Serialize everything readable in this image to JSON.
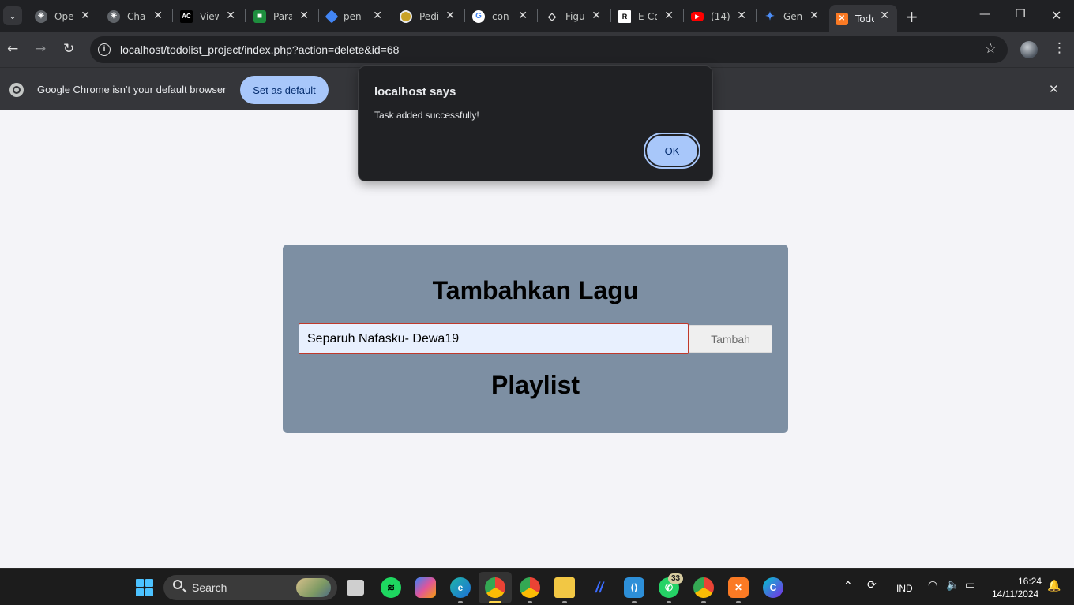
{
  "browser": {
    "tabs": [
      {
        "title": "Ope",
        "icon": "openai-icon",
        "color": "#5f6368"
      },
      {
        "title": "Cha",
        "icon": "chatgpt-icon",
        "color": "#5f6368"
      },
      {
        "title": "View",
        "icon": "ac-icon",
        "color": "#000000"
      },
      {
        "title": "Para",
        "icon": "robot-icon",
        "color": "#1e8e3e"
      },
      {
        "title": "pen",
        "icon": "graduation-cap-icon",
        "color": "#4285f4"
      },
      {
        "title": "Pedi",
        "icon": "university-seal-icon",
        "color": "#c9a227"
      },
      {
        "title": "con",
        "icon": "google-icon",
        "color": "#4285f4"
      },
      {
        "title": "Figu",
        "icon": "figure-icon",
        "color": "#5f6368"
      },
      {
        "title": "E-Co",
        "icon": "re-icon",
        "color": "#ffffff"
      },
      {
        "title": "(14)",
        "icon": "youtube-icon",
        "color": "#ff0000"
      },
      {
        "title": "Gem",
        "icon": "gemini-icon",
        "color": "#4c8df6"
      },
      {
        "title": "Todo",
        "icon": "xampp-icon",
        "color": "#fb7a24"
      }
    ],
    "url": "localhost/todolist_project/index.php?action=delete&id=68"
  },
  "infobar": {
    "message": "Google Chrome isn't your default browser",
    "button": "Set as default"
  },
  "dialog": {
    "title": "localhost says",
    "message": "Task added successfully!",
    "ok": "OK"
  },
  "page": {
    "heading": "Tambahkan Lagu",
    "input_value": "Separuh Nafasku- Dewa19",
    "add_button": "Tambah",
    "playlist_heading": "Playlist"
  },
  "taskbar": {
    "search_label": "Search",
    "whatsapp_badge": "33",
    "language": "IND",
    "time": "16:24",
    "date": "14/11/2024"
  }
}
